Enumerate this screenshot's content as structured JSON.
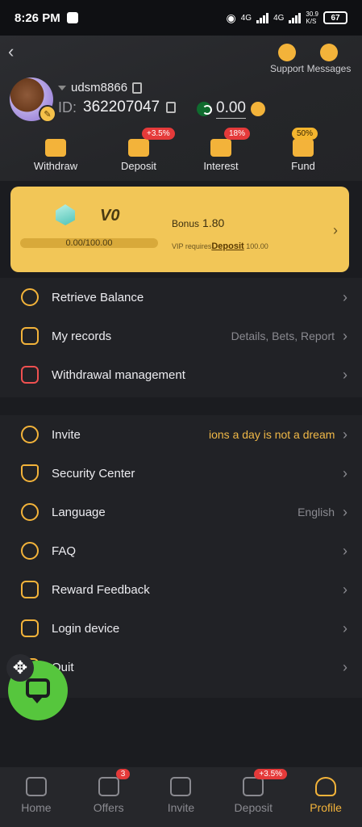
{
  "status_bar": {
    "time": "8:26 PM",
    "net1": "4G",
    "net2": "4G",
    "speed": "30.9",
    "speed_unit": "K/S",
    "battery": "67"
  },
  "header": {
    "support_label": "Support",
    "messages_label": "Messages",
    "username": "udsm8866",
    "id_label": "ID:",
    "id_value": "362207047",
    "balance": "0.00"
  },
  "actions": [
    {
      "label": "Withdraw",
      "badge": ""
    },
    {
      "label": "Deposit",
      "badge": "+3.5%"
    },
    {
      "label": "Interest",
      "badge": "18%"
    },
    {
      "label": "Fund",
      "badge": "50%"
    }
  ],
  "vip": {
    "level": "V0",
    "progress_text": "0.00/100.00",
    "progress_fraction": 0,
    "bonus_label": "Bonus",
    "bonus_value": "1.80",
    "req_prefix": "VIP requires",
    "req_link": "Deposit",
    "req_amount": "100.00"
  },
  "menu1": [
    {
      "label": "Retrieve Balance",
      "sub": ""
    },
    {
      "label": "My records",
      "sub": "Details, Bets, Report"
    },
    {
      "label": "Withdrawal management",
      "sub": ""
    }
  ],
  "menu2": [
    {
      "label": "Invite",
      "sub": "ions a day is not a dream"
    },
    {
      "label": "Security Center",
      "sub": ""
    },
    {
      "label": "Language",
      "sub": "English"
    },
    {
      "label": "FAQ",
      "sub": ""
    },
    {
      "label": "Reward Feedback",
      "sub": ""
    },
    {
      "label": "Login device",
      "sub": ""
    },
    {
      "label": "Quit",
      "sub": ""
    }
  ],
  "nav": [
    {
      "label": "Home",
      "badge": ""
    },
    {
      "label": "Offers",
      "badge": "3"
    },
    {
      "label": "Invite",
      "badge": ""
    },
    {
      "label": "Deposit",
      "badge": "+3.5%"
    },
    {
      "label": "Profile",
      "badge": ""
    }
  ]
}
